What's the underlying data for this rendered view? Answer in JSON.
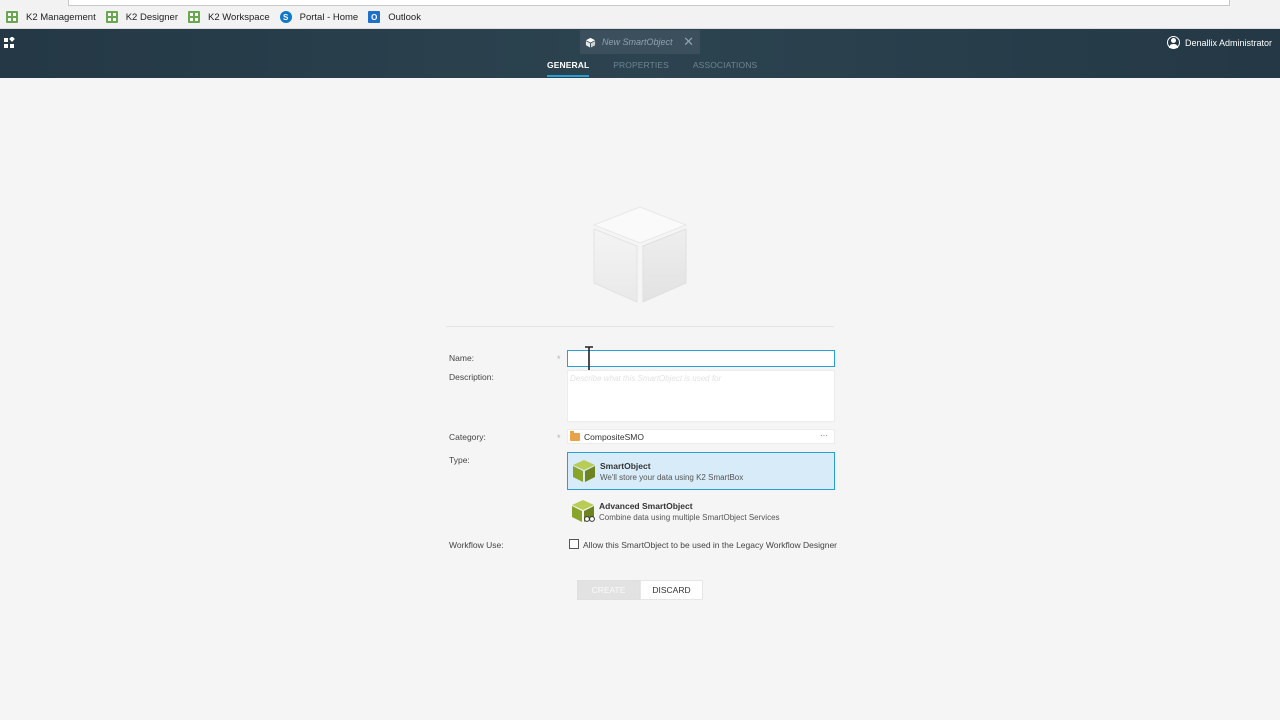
{
  "bookmarks": [
    {
      "label": "K2 Management",
      "icon": "k2-grid-icon"
    },
    {
      "label": "K2 Designer",
      "icon": "k2-grid-icon"
    },
    {
      "label": "K2 Workspace",
      "icon": "k2-grid-icon"
    },
    {
      "label": "Portal - Home",
      "icon": "sharepoint-icon"
    },
    {
      "label": "Outlook",
      "icon": "outlook-icon"
    }
  ],
  "header": {
    "doc_tab_title": "New SmartObject",
    "user_name": "Denallix Administrator",
    "tabs": [
      {
        "label": "GENERAL",
        "active": true
      },
      {
        "label": "PROPERTIES",
        "active": false
      },
      {
        "label": "ASSOCIATIONS",
        "active": false
      }
    ]
  },
  "form": {
    "name_label": "Name:",
    "name_value": "",
    "description_label": "Description:",
    "description_placeholder": "Describe what this SmartObject is used for",
    "category_label": "Category:",
    "category_value": "CompositeSMO",
    "category_more": "···",
    "type_label": "Type:",
    "types": [
      {
        "title": "SmartObject",
        "subtitle": "We'll store your data using K2 SmartBox",
        "selected": true
      },
      {
        "title": "Advanced SmartObject",
        "subtitle": "Combine data using multiple SmartObject Services",
        "selected": false
      }
    ],
    "workflow_label": "Workflow Use:",
    "workflow_checkbox_label": "Allow this SmartObject to be used in the Legacy Workflow Designer",
    "workflow_checked": false,
    "required_marker": "*"
  },
  "buttons": {
    "create": "CREATE",
    "discard": "DISCARD"
  },
  "colors": {
    "header_bg": "#2c4350",
    "accent": "#2a9fd6",
    "selected_bg": "#d7ecf8",
    "cube_green": "#8aa329"
  }
}
